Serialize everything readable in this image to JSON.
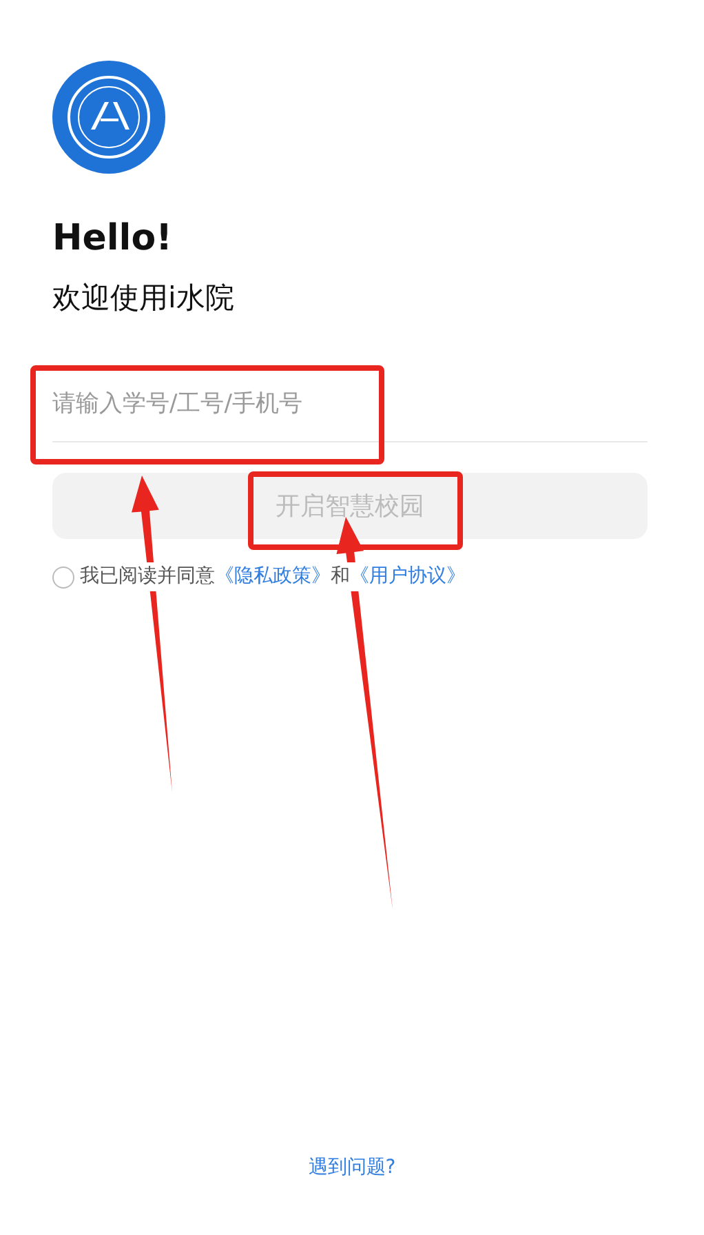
{
  "greeting": "Hello!",
  "welcome": "欢迎使用i水院",
  "account_field": {
    "placeholder": "请输入学号/工号/手机号",
    "highlighted": true,
    "arrow": true
  },
  "login_button": {
    "label": "开启智慧校园",
    "disabled": true,
    "highlighted": true,
    "arrow": true
  },
  "agreement": {
    "checked": false,
    "parts": [
      {
        "kind": "text",
        "text": "我已阅读并同意"
      },
      {
        "kind": "link",
        "text": "《隐私政策》"
      },
      {
        "kind": "text",
        "text": "和"
      },
      {
        "kind": "link",
        "text": "《用户协议》"
      }
    ]
  },
  "help_link": "遇到问题?"
}
